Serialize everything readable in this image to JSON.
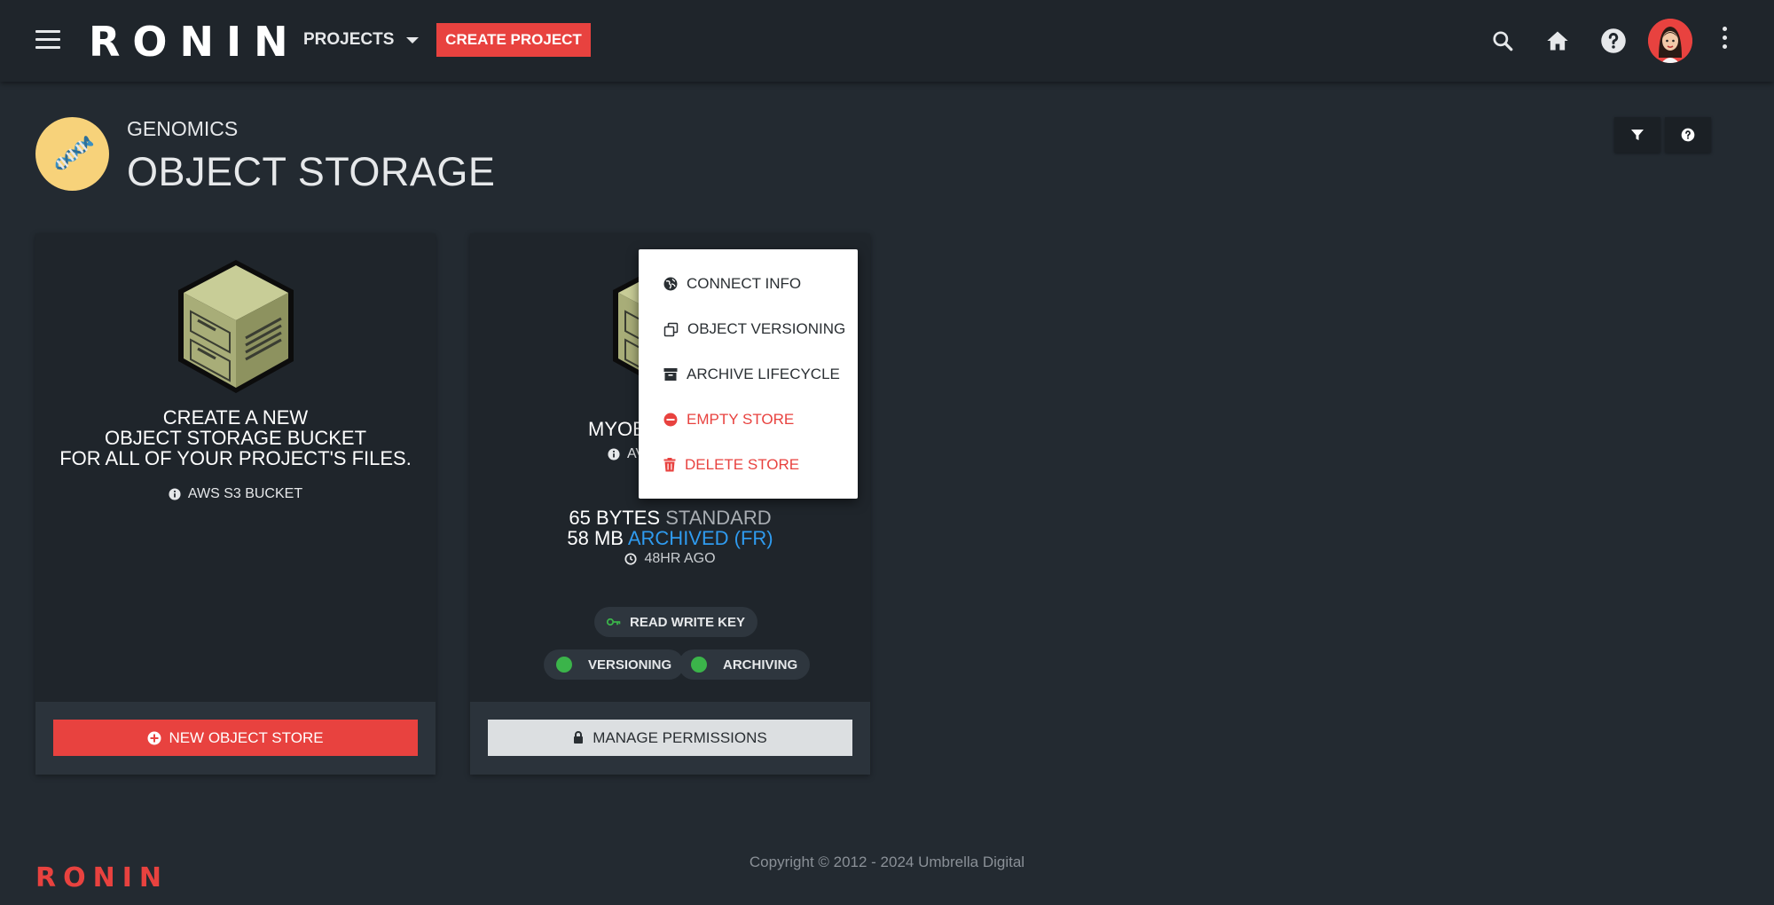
{
  "header": {
    "brand": "RONIN",
    "projects_label": "PROJECTS",
    "create_project_label": "CREATE PROJECT",
    "icons": [
      "menu-icon",
      "search-icon",
      "home-icon",
      "help-icon",
      "avatar",
      "more-vert-icon"
    ]
  },
  "page": {
    "project_name": "GENOMICS",
    "title": "OBJECT STORAGE"
  },
  "new_store_card": {
    "line1": "CREATE A NEW",
    "line2": "OBJECT STORAGE BUCKET",
    "line3": "FOR ALL OF YOUR PROJECT'S FILES.",
    "info": "AWS S3 BUCKET",
    "button_label": "NEW OBJECT STORE"
  },
  "store_card": {
    "name_partial": "MYOB",
    "info_partial": "AV",
    "size_standard_value": "65 BYTES",
    "size_standard_label": "STANDARD",
    "size_archived_value": "58 MB",
    "size_archived_label": "ARCHIVED (FR)",
    "updated": "48HR AGO",
    "key_chip": "READ WRITE KEY",
    "versioning_chip": "VERSIONING",
    "archiving_chip": "ARCHIVING",
    "button_label": "MANAGE PERMISSIONS"
  },
  "context_menu": {
    "items": [
      {
        "label": "CONNECT INFO",
        "icon": "globe-icon"
      },
      {
        "label": "OBJECT VERSIONING",
        "icon": "copy-icon"
      },
      {
        "label": "ARCHIVE LIFECYCLE",
        "icon": "archive-icon"
      },
      {
        "label": "EMPTY STORE",
        "icon": "minus-circle-icon"
      },
      {
        "label": "DELETE STORE",
        "icon": "trash-icon"
      }
    ]
  },
  "footer": {
    "brand": "RONIN",
    "copyright": "Copyright © 2012 - 2024 Umbrella Digital"
  },
  "colors": {
    "background": "#232a31",
    "topbar": "#1f252b",
    "accent_red": "#e8423f",
    "archived_blue": "#2f9bef",
    "status_green": "#3bb44a"
  }
}
